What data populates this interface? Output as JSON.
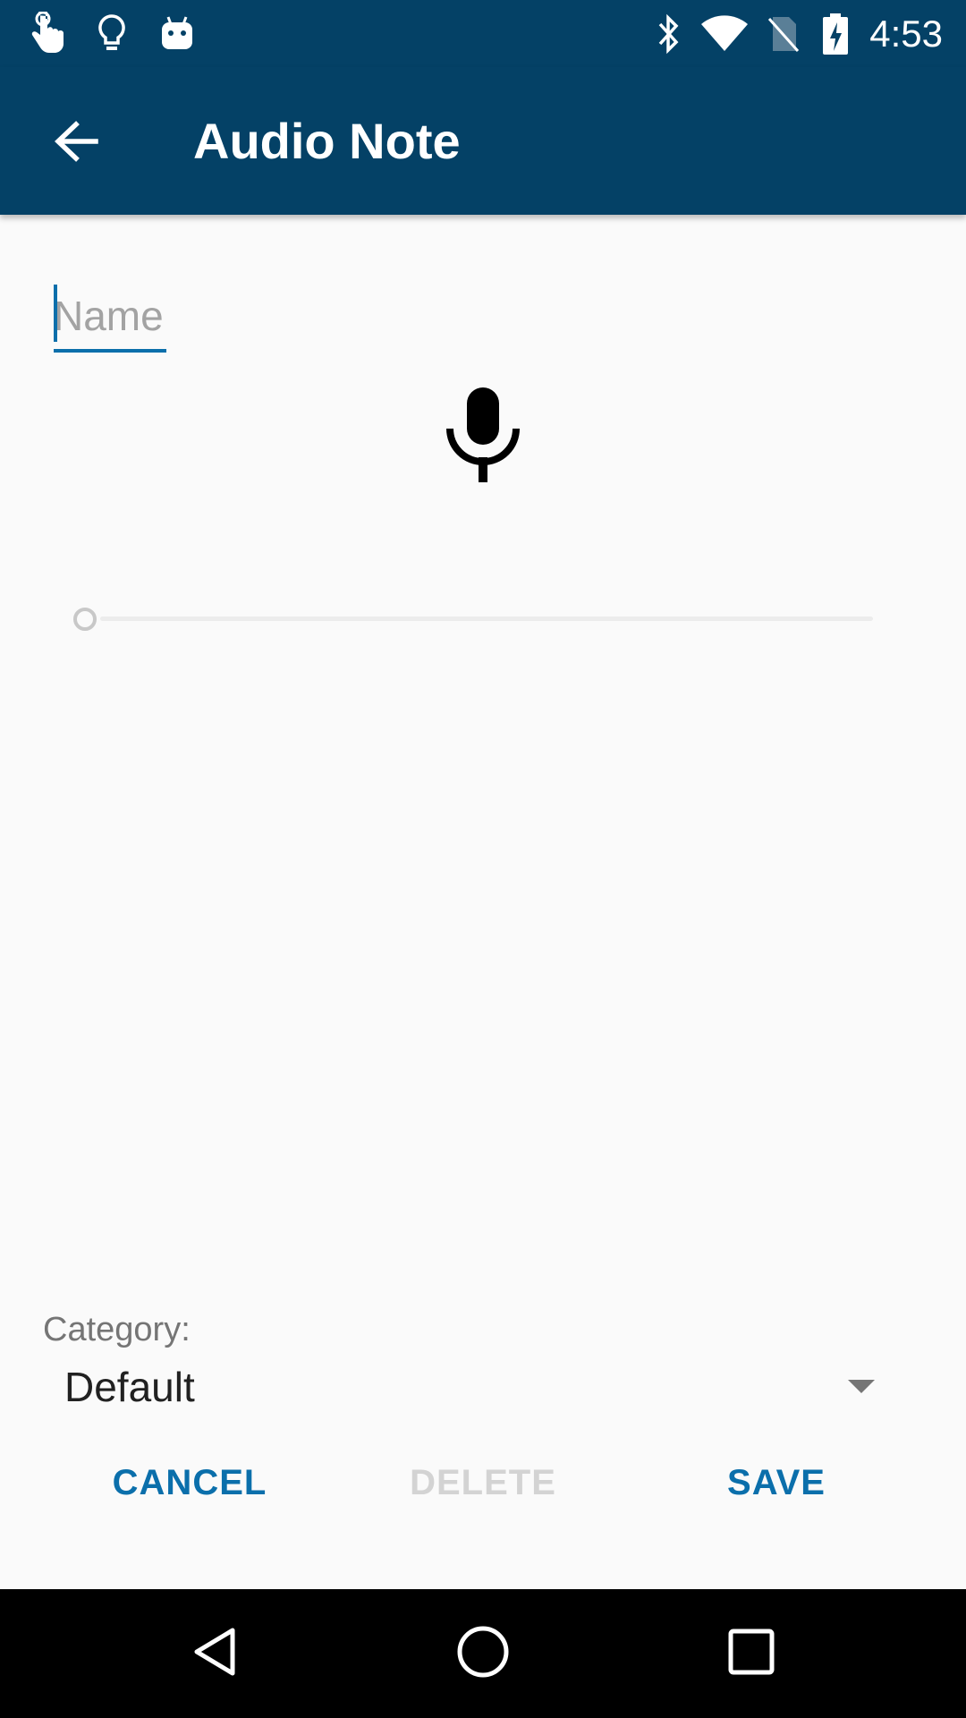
{
  "status_bar": {
    "time": "4:53",
    "left_icons": [
      "touch-gesture-icon",
      "lightbulb-icon",
      "android-robot-icon"
    ],
    "right_icons": [
      "bluetooth-icon",
      "wifi-icon",
      "no-sim-icon",
      "battery-charging-icon"
    ]
  },
  "app_bar": {
    "title": "Audio Note",
    "back_icon": "arrow-back-icon",
    "background": "#044166"
  },
  "form": {
    "name_placeholder": "Name",
    "name_value": "",
    "record_icon": "microphone-icon",
    "seek_progress": 0,
    "category_label": "Category:",
    "category_value": "Default"
  },
  "actions": {
    "cancel": "CANCEL",
    "delete": "DELETE",
    "save": "SAVE",
    "accent_color": "#0b6fab",
    "disabled_color": "#d3d3d3"
  },
  "nav_bar": {
    "icons": [
      "nav-back-icon",
      "nav-home-icon",
      "nav-recents-icon"
    ]
  }
}
